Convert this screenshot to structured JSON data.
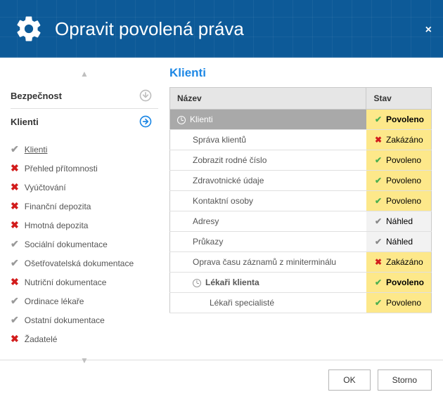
{
  "header": {
    "title": "Opravit povolená práva"
  },
  "sidebar": {
    "sections": {
      "security": {
        "label": "Bezpečnost"
      },
      "clients": {
        "label": "Klienti"
      }
    },
    "items": [
      {
        "label": "Klienti",
        "status": "check",
        "underline": true
      },
      {
        "label": "Přehled přítomnosti",
        "status": "x"
      },
      {
        "label": "Vyúčtování",
        "status": "x"
      },
      {
        "label": "Finanční depozita",
        "status": "x"
      },
      {
        "label": "Hmotná depozita",
        "status": "x"
      },
      {
        "label": "Sociální dokumentace",
        "status": "check"
      },
      {
        "label": "Ošetřovatelská dokumentace",
        "status": "check"
      },
      {
        "label": "Nutriční dokumentace",
        "status": "x"
      },
      {
        "label": "Ordinace lékaře",
        "status": "check"
      },
      {
        "label": "Ostatní dokumentace",
        "status": "check"
      },
      {
        "label": "Žadatelé",
        "status": "x"
      }
    ]
  },
  "main": {
    "title": "Klienti",
    "columns": {
      "name": "Název",
      "state": "Stav"
    },
    "rows": [
      {
        "name": "Klienti",
        "state": "Povoleno",
        "state_kind": "allow",
        "indent": 0,
        "clock": true,
        "selected": true,
        "bold": false
      },
      {
        "name": "Správa klientů",
        "state": "Zakázáno",
        "state_kind": "deny",
        "indent": 1
      },
      {
        "name": "Zobrazit rodné číslo",
        "state": "Povoleno",
        "state_kind": "allow",
        "indent": 1
      },
      {
        "name": "Zdravotnické údaje",
        "state": "Povoleno",
        "state_kind": "allow",
        "indent": 1
      },
      {
        "name": "Kontaktní osoby",
        "state": "Povoleno",
        "state_kind": "allow",
        "indent": 1
      },
      {
        "name": "Adresy",
        "state": "Náhled",
        "state_kind": "view",
        "indent": 1
      },
      {
        "name": "Průkazy",
        "state": "Náhled",
        "state_kind": "view",
        "indent": 1
      },
      {
        "name": "Oprava času záznamů z miniterminálu",
        "state": "Zakázáno",
        "state_kind": "deny",
        "indent": 1
      },
      {
        "name": "Lékaři klienta",
        "state": "Povoleno",
        "state_kind": "allow",
        "indent": 1,
        "clock": true,
        "bold": true
      },
      {
        "name": "Lékaři specialisté",
        "state": "Povoleno",
        "state_kind": "allow",
        "indent": 2
      }
    ]
  },
  "footer": {
    "ok": "OK",
    "cancel": "Storno"
  }
}
